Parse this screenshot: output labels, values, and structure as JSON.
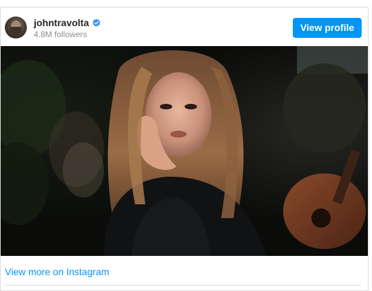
{
  "post": {
    "username": "johntravolta",
    "followers": "4.8M followers",
    "view_profile_label": "View profile",
    "view_more_label": "View more on Instagram"
  },
  "icons": {
    "verified": "verified-badge-icon",
    "avatar": "avatar"
  },
  "colors": {
    "accent": "#0095f6",
    "muted": "#8e8e8e",
    "text": "#262626",
    "border": "#dbdbdb"
  }
}
